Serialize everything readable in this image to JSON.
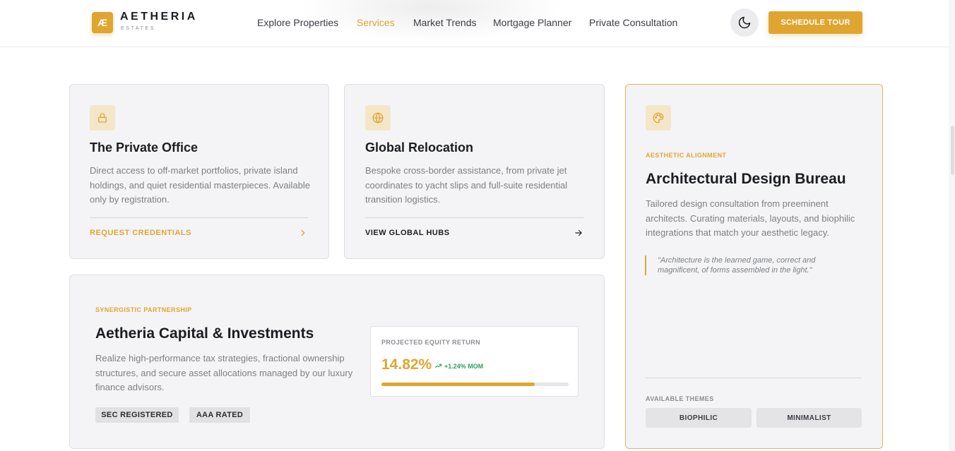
{
  "brand": {
    "mark": "Æ",
    "name": "AETHERIA",
    "sub": "ESTATES"
  },
  "nav": {
    "items": [
      {
        "label": "Explore Properties"
      },
      {
        "label": "Services"
      },
      {
        "label": "Market Trends"
      },
      {
        "label": "Mortgage Planner"
      },
      {
        "label": "Private Consultation"
      }
    ],
    "active": "Services",
    "theme_toggle_icon": "moon-icon",
    "cta_label": "SCHEDULE TOUR"
  },
  "colors": {
    "accent": "#e0a530",
    "positive": "#2e9e62",
    "card_bg": "#f4f4f6"
  },
  "cards": {
    "private_office": {
      "icon": "lock-icon",
      "title": "The Private Office",
      "desc": "Direct access to off-market portfolios, private island holdings, and quiet residential masterpieces. Available only by registration.",
      "link": "REQUEST CREDENTIALS",
      "link_icon": "chevron-right-icon"
    },
    "global_relocation": {
      "icon": "globe-icon",
      "title": "Global Relocation",
      "desc": "Bespoke cross-border assistance, from private jet coordinates to yacht slips and full-suite residential transition logistics.",
      "link": "VIEW GLOBAL HUBS",
      "link_icon": "arrow-right-icon"
    },
    "design_bureau": {
      "icon": "palette-icon",
      "eyebrow": "AESTHETIC ALIGNMENT",
      "title": "Architectural Design Bureau",
      "desc": "Tailored design consultation from preeminent architects. Curating materials, layouts, and biophilic integrations that match your aesthetic legacy.",
      "quote": "\"Architecture is the learned game, correct and magnificent, of forms assembled in the light.\"",
      "themes_label": "AVAILABLE THEMES",
      "themes": [
        "BIOPHILIC",
        "MINIMALIST"
      ]
    },
    "capital": {
      "eyebrow": "SYNERGISTIC PARTNERSHIP",
      "title": "Aetheria Capital & Investments",
      "desc": "Realize high-performance tax strategies, fractional ownership structures, and secure asset allocations managed by our luxury finance advisors.",
      "tags": [
        "SEC REGISTERED",
        "AAA RATED"
      ],
      "metric": {
        "label": "PROJECTED EQUITY RETURN",
        "value": "14.82%",
        "trend": "+1.24% MOM",
        "trend_icon": "trending-up-icon",
        "progress": 0.82
      }
    }
  }
}
